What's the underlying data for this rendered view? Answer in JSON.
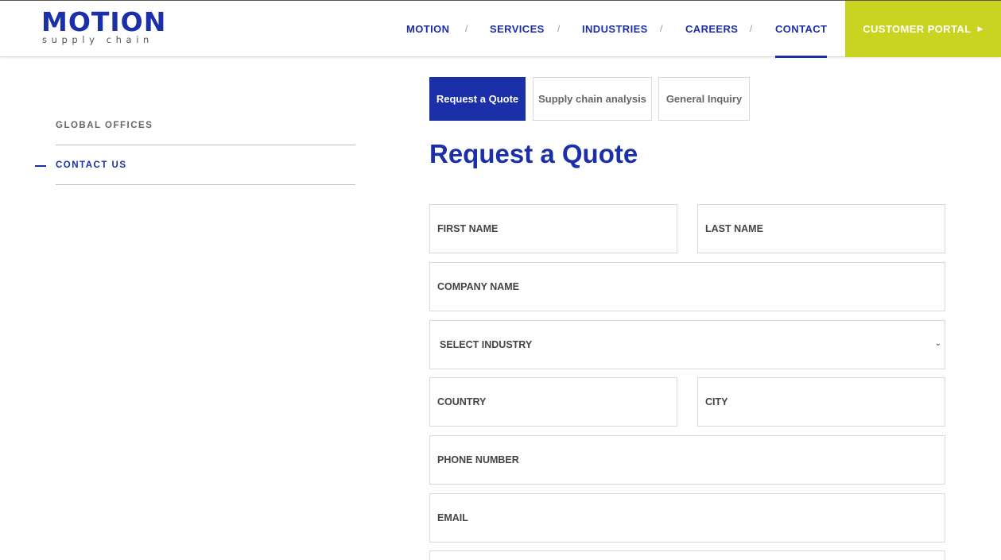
{
  "logo": {
    "main": "MOTION",
    "sub": "supply chain"
  },
  "nav": {
    "items": [
      {
        "label": "MOTION"
      },
      {
        "label": "SERVICES"
      },
      {
        "label": "INDUSTRIES"
      },
      {
        "label": "CAREERS"
      },
      {
        "label": "CONTACT"
      }
    ],
    "separator": "/",
    "portal_label": "CUSTOMER PORTAL",
    "portal_arrow": "▶"
  },
  "sidebar": {
    "items": [
      {
        "label": "GLOBAL OFFICES"
      },
      {
        "label": "CONTACT US"
      }
    ]
  },
  "tabs": [
    {
      "label": "Request a Quote"
    },
    {
      "label": "Supply chain analysis"
    },
    {
      "label": "General Inquiry"
    }
  ],
  "form": {
    "title": "Request a Quote",
    "first_name": "FIRST NAME",
    "last_name": "LAST NAME",
    "company": "COMPANY NAME",
    "industry": "SELECT INDUSTRY",
    "country": "COUNTRY",
    "city": "CITY",
    "phone": "PHONE NUMBER",
    "email": "EMAIL"
  },
  "colors": {
    "brand": "#1a2fa8",
    "portal": "#c8d41f"
  }
}
